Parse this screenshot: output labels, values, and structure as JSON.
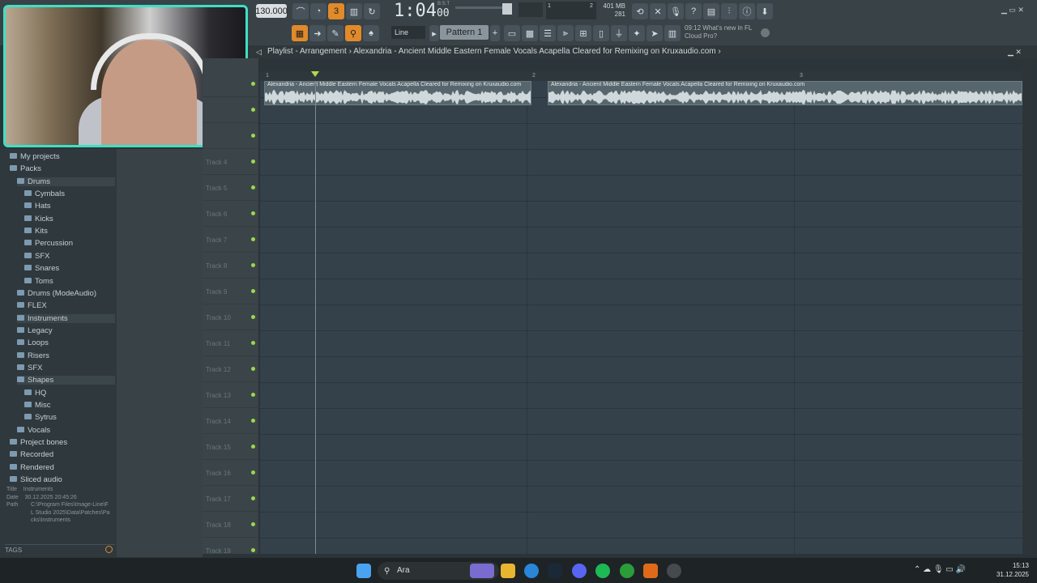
{
  "toolbar": {
    "tempo": "130.000",
    "time": "1:04",
    "time_ticks": "00",
    "time_sub": "B:S:T",
    "memory": "401 MB",
    "memory_sub": "281",
    "snap": "Line",
    "pattern": "Pattern 1",
    "news_time": "09:12",
    "news_title": "What's new in FL",
    "news_sub": "Cloud Pro?",
    "meter_left": "1",
    "meter_right": "2"
  },
  "breadcrumb": {
    "prefix": "Playlist - Arrangement",
    "sep": "›",
    "title": "Alexandria - Ancient Middle Eastern Female Vocals Acapella  Cleared for Remixing on Kruxaudio.com",
    "end": "›"
  },
  "browser": {
    "items": [
      {
        "label": "My projects",
        "indent": 0
      },
      {
        "label": "Packs",
        "indent": 0
      },
      {
        "label": "Drums",
        "indent": 1
      },
      {
        "label": "Cymbals",
        "indent": 2
      },
      {
        "label": "Hats",
        "indent": 2
      },
      {
        "label": "Kicks",
        "indent": 2
      },
      {
        "label": "Kits",
        "indent": 2
      },
      {
        "label": "Percussion",
        "indent": 2
      },
      {
        "label": "SFX",
        "indent": 2
      },
      {
        "label": "Snares",
        "indent": 2
      },
      {
        "label": "Toms",
        "indent": 2
      },
      {
        "label": "Drums (ModeAudio)",
        "indent": 1
      },
      {
        "label": "FLEX",
        "indent": 1
      },
      {
        "label": "Instruments",
        "indent": 1
      },
      {
        "label": "Legacy",
        "indent": 1
      },
      {
        "label": "Loops",
        "indent": 1
      },
      {
        "label": "Risers",
        "indent": 1
      },
      {
        "label": "SFX",
        "indent": 1
      },
      {
        "label": "Shapes",
        "indent": 1
      },
      {
        "label": "HQ",
        "indent": 2
      },
      {
        "label": "Misc",
        "indent": 2
      },
      {
        "label": "Sytrus",
        "indent": 2
      },
      {
        "label": "Vocals",
        "indent": 1
      },
      {
        "label": "Project bones",
        "indent": 0
      },
      {
        "label": "Recorded",
        "indent": 0
      },
      {
        "label": "Rendered",
        "indent": 0
      },
      {
        "label": "Sliced audio",
        "indent": 0
      }
    ],
    "meta_title_key": "Title",
    "meta_title": "Instruments",
    "meta_date_key": "Date",
    "meta_date": "30.12.2025 20:45:26",
    "meta_path_key": "Path",
    "meta_path": "C:\\Program Files\\Image-Line\\FL Studio 2025\\Data\\Patches\\Packs\\Instruments",
    "tags": "TAGS"
  },
  "playlist": {
    "tracks": [
      "Track 4",
      "Track 5",
      "Track 6",
      "Track 7",
      "Track 8",
      "Track 9",
      "Track 10",
      "Track 11",
      "Track 12",
      "Track 13",
      "Track 14",
      "Track 15",
      "Track 16",
      "Track 17",
      "Track 18",
      "Track 19"
    ],
    "ruler": [
      "1",
      "2",
      "3"
    ],
    "clip_title": "Alexandria - Ancient Middle Eastern Female Vocals Acapella  Cleared for Remixing on Kruxaudio.com"
  },
  "taskbar": {
    "search_placeholder": "Ara",
    "time": "15:13",
    "date": "31.12.2025"
  },
  "colors": {
    "accent": "#e08a2a",
    "webcam_frame": "#3ee0c4",
    "track_led": "#9cd84a"
  }
}
